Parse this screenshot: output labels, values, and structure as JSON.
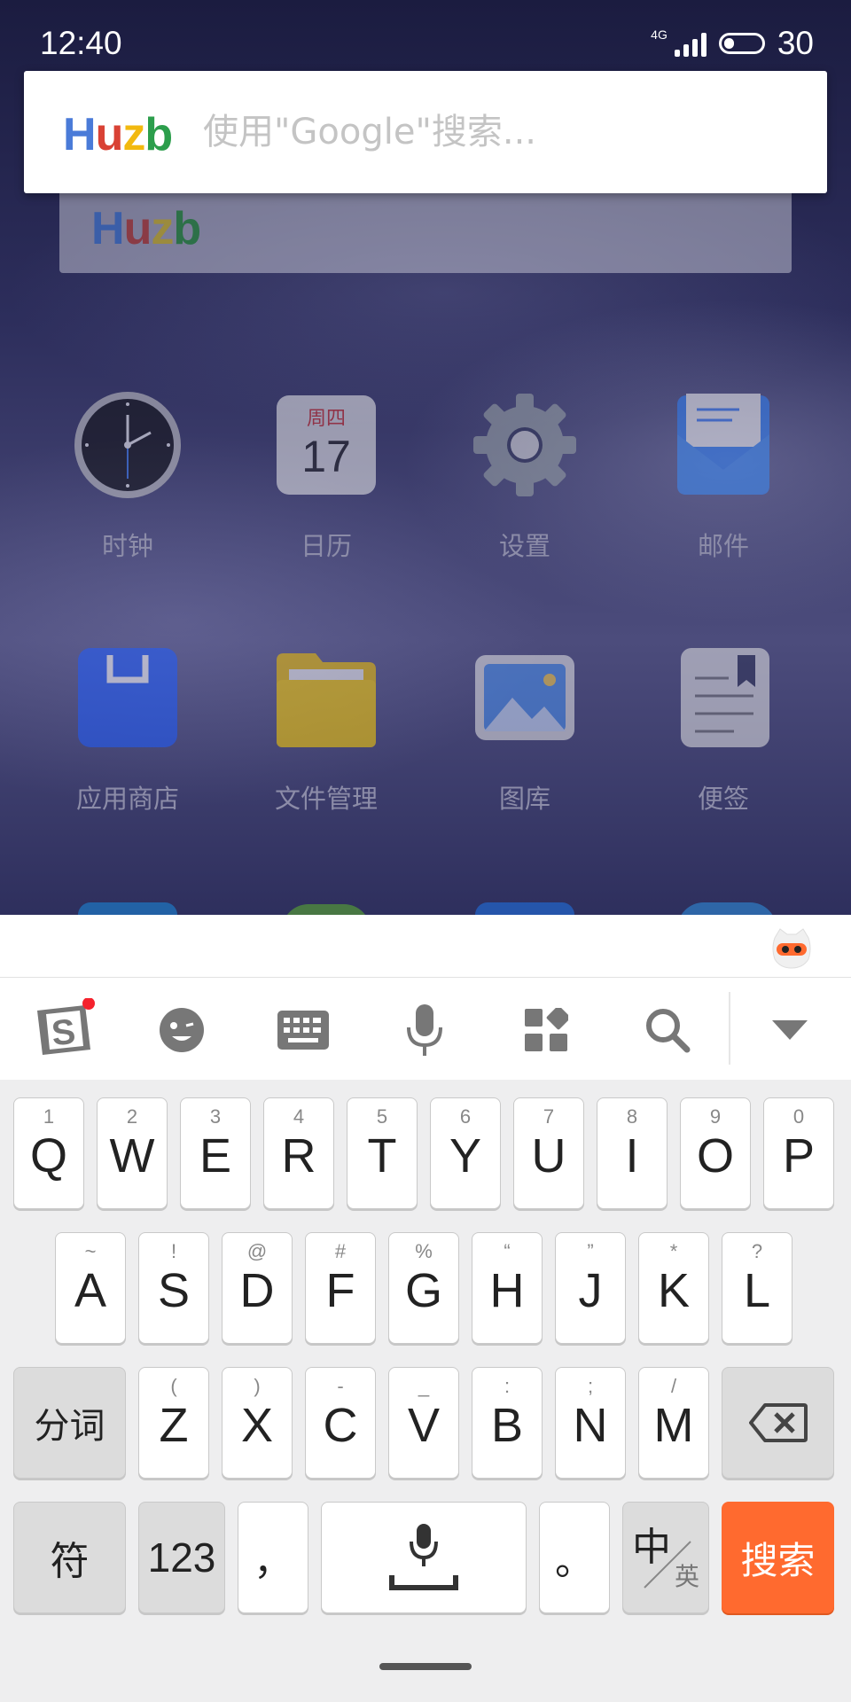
{
  "status_bar": {
    "time": "12:40",
    "network": "4G",
    "battery": "30"
  },
  "search_widget": {
    "logo": [
      "H",
      "u",
      "z",
      "b"
    ],
    "placeholder": "使用\"Google\"搜索..."
  },
  "background_widget": {
    "logo": [
      "H",
      "u",
      "z",
      "b"
    ]
  },
  "calendar": {
    "weekday": "周四",
    "day": "17"
  },
  "apps": [
    {
      "label": "时钟",
      "icon": "clock-icon"
    },
    {
      "label": "日历",
      "icon": "calendar-icon"
    },
    {
      "label": "设置",
      "icon": "settings-gear-icon"
    },
    {
      "label": "邮件",
      "icon": "mail-icon"
    },
    {
      "label": "应用商店",
      "icon": "app-store-icon"
    },
    {
      "label": "文件管理",
      "icon": "folder-icon"
    },
    {
      "label": "图库",
      "icon": "gallery-icon"
    },
    {
      "label": "便签",
      "icon": "notes-icon"
    }
  ],
  "keyboard": {
    "toolbar": [
      "sogou-logo-icon",
      "emoji-icon",
      "keyboard-icon",
      "microphone-icon",
      "apps-grid-icon",
      "search-icon",
      "collapse-icon"
    ],
    "row1": [
      {
        "main": "Q",
        "sub": "1"
      },
      {
        "main": "W",
        "sub": "2"
      },
      {
        "main": "E",
        "sub": "3"
      },
      {
        "main": "R",
        "sub": "4"
      },
      {
        "main": "T",
        "sub": "5"
      },
      {
        "main": "Y",
        "sub": "6"
      },
      {
        "main": "U",
        "sub": "7"
      },
      {
        "main": "I",
        "sub": "8"
      },
      {
        "main": "O",
        "sub": "9"
      },
      {
        "main": "P",
        "sub": "0"
      }
    ],
    "row2": [
      {
        "main": "A",
        "sub": "~"
      },
      {
        "main": "S",
        "sub": "!"
      },
      {
        "main": "D",
        "sub": "@"
      },
      {
        "main": "F",
        "sub": "#"
      },
      {
        "main": "G",
        "sub": "%"
      },
      {
        "main": "H",
        "sub": "“"
      },
      {
        "main": "J",
        "sub": "”"
      },
      {
        "main": "K",
        "sub": "*"
      },
      {
        "main": "L",
        "sub": "?"
      }
    ],
    "row3": [
      {
        "main": "Z",
        "sub": "("
      },
      {
        "main": "X",
        "sub": ")"
      },
      {
        "main": "C",
        "sub": "-"
      },
      {
        "main": "V",
        "sub": "_"
      },
      {
        "main": "B",
        "sub": ":"
      },
      {
        "main": "N",
        "sub": ";"
      },
      {
        "main": "M",
        "sub": "/"
      }
    ],
    "segment_key": "分词",
    "symbol_key": "符",
    "number_key": "123",
    "comma_key": "，",
    "period_key": "。",
    "lang_key_main": "中",
    "lang_key_sub": "英",
    "search_key": "搜索"
  }
}
